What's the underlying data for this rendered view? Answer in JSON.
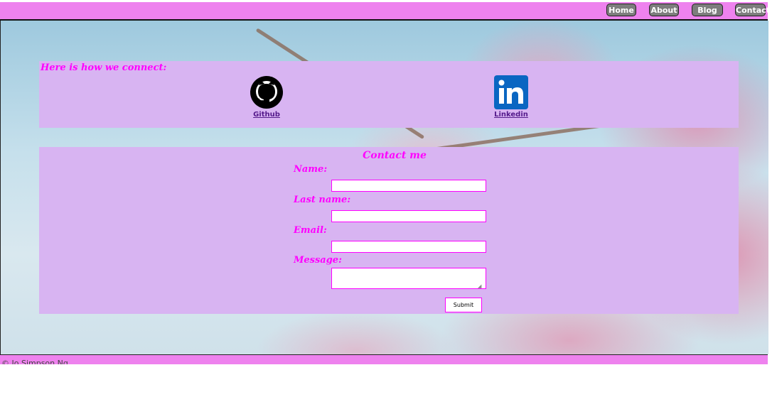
{
  "nav": {
    "items": [
      {
        "label": "Home"
      },
      {
        "label": "About"
      },
      {
        "label": "Blog"
      },
      {
        "label": "Contact"
      }
    ]
  },
  "connect": {
    "title": "Here is how we connect:",
    "github": {
      "label": "Github",
      "icon": "github-icon"
    },
    "linkedin": {
      "label": "Linkedin",
      "icon": "linkedin-icon"
    }
  },
  "contact": {
    "title": "Contact me",
    "name_label": "Name:",
    "lastname_label": "Last name:",
    "email_label": "Email:",
    "message_label": "Message:",
    "name_value": "",
    "lastname_value": "",
    "email_value": "",
    "message_value": "",
    "submit_label": "Submit"
  },
  "footer": {
    "text": "© Jo Simpson Ng"
  },
  "colors": {
    "nav_bar": "#ee82ee",
    "panel": "#d8b4f2",
    "accent": "#ff00ff",
    "nav_button": "#7d7d7d",
    "link": "#551a8b"
  }
}
